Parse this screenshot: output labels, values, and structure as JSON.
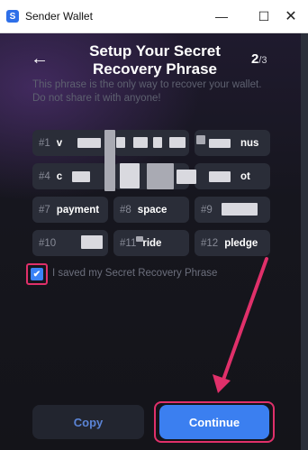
{
  "window": {
    "title": "Sender Wallet",
    "app_icon_glyph": "S",
    "minimize_glyph": "—",
    "maximize_glyph": "☐",
    "close_glyph": "✕"
  },
  "header": {
    "back_glyph": "←",
    "title": "Setup Your Secret Recovery Phrase",
    "step_current": "2",
    "step_total": "/3"
  },
  "subtitle": "This phrase is the only way to recover your wallet. Do not share it with anyone!",
  "phrase": [
    {
      "num": "#1",
      "word": "v"
    },
    {
      "num": "",
      "word": ""
    },
    {
      "num": "",
      "word": "nus"
    },
    {
      "num": "#4",
      "word": "c"
    },
    {
      "num": "",
      "word": ""
    },
    {
      "num": "",
      "word": "ot"
    },
    {
      "num": "#7",
      "word": "payment"
    },
    {
      "num": "#8",
      "word": "space"
    },
    {
      "num": "#9",
      "word": ""
    },
    {
      "num": "#10",
      "word": ""
    },
    {
      "num": "#11",
      "word": "ride"
    },
    {
      "num": "#12",
      "word": "pledge"
    }
  ],
  "checkbox": {
    "checked_glyph": "✔",
    "label": "I saved my Secret Recovery Phrase"
  },
  "buttons": {
    "copy": "Copy",
    "continue": "Continue"
  },
  "colors": {
    "accent": "#3b7ff0",
    "highlight": "#e0306a"
  }
}
